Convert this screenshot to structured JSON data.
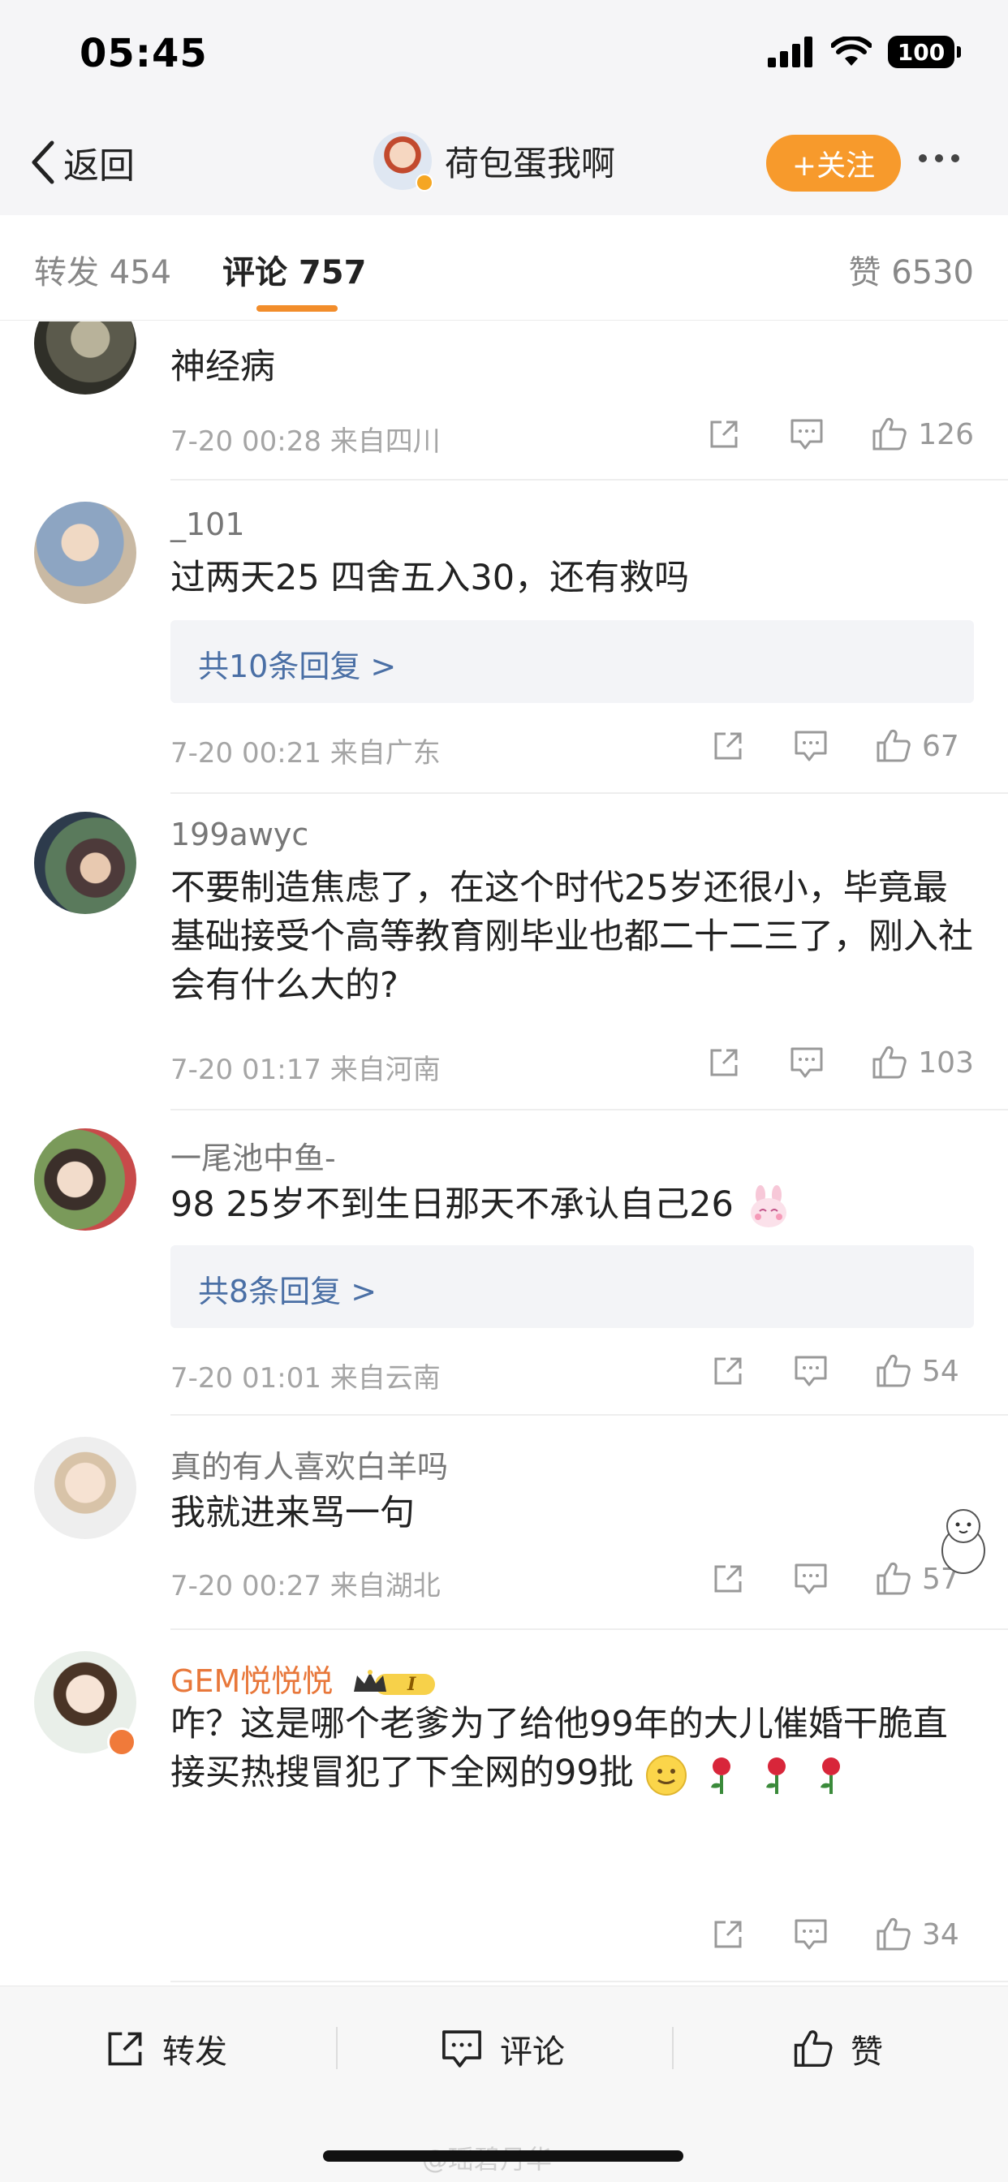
{
  "status_bar": {
    "time": "05:45",
    "battery": "100"
  },
  "nav": {
    "back_label": "返回",
    "title": "荷包蛋我啊",
    "follow_label": "+关注"
  },
  "tabs": {
    "repost": "转发 454",
    "comment": "评论 757",
    "like": "赞 6530"
  },
  "comments": [
    {
      "username": "",
      "text": "神经病",
      "replies": "",
      "meta": "7-20 00:28 来自四川",
      "likes": "126"
    },
    {
      "username": "_101",
      "text": "过两天25 四舍五入30，还有救吗",
      "replies": "共10条回复 >",
      "meta": "7-20 00:21 来自广东",
      "likes": "67"
    },
    {
      "username": "199awyc",
      "text": "不要制造焦虑了，在这个时代25岁还很小，毕竟最基础接受个高等教育刚毕业也都二十二三了，刚入社会有什么大的?",
      "replies": "",
      "meta": "7-20 01:17 来自河南",
      "likes": "103"
    },
    {
      "username": "一尾池中鱼-",
      "text": "98 25岁不到生日那天不承认自己26",
      "replies": "共8条回复 >",
      "meta": "7-20 01:01 来自云南",
      "likes": "54"
    },
    {
      "username": "真的有人喜欢白羊吗",
      "text": "我就进来骂一句",
      "replies": "",
      "meta": "7-20 00:27 来自湖北",
      "likes": "57"
    },
    {
      "username": "GEM悦悦悦",
      "vip_level": "I",
      "text": "咋？这是哪个老爹为了给他99年的大儿催婚干脆直接买热搜冒犯了下全网的99批",
      "replies": "",
      "meta": "",
      "likes": "34"
    }
  ],
  "bottom_bar": {
    "repost": "转发",
    "comment": "评论",
    "like": "赞"
  },
  "watermark": "@瑶碧丹华",
  "colors": {
    "accent": "#f79a2c",
    "link": "#4a6fa5",
    "vip_name": "#e8773a"
  }
}
